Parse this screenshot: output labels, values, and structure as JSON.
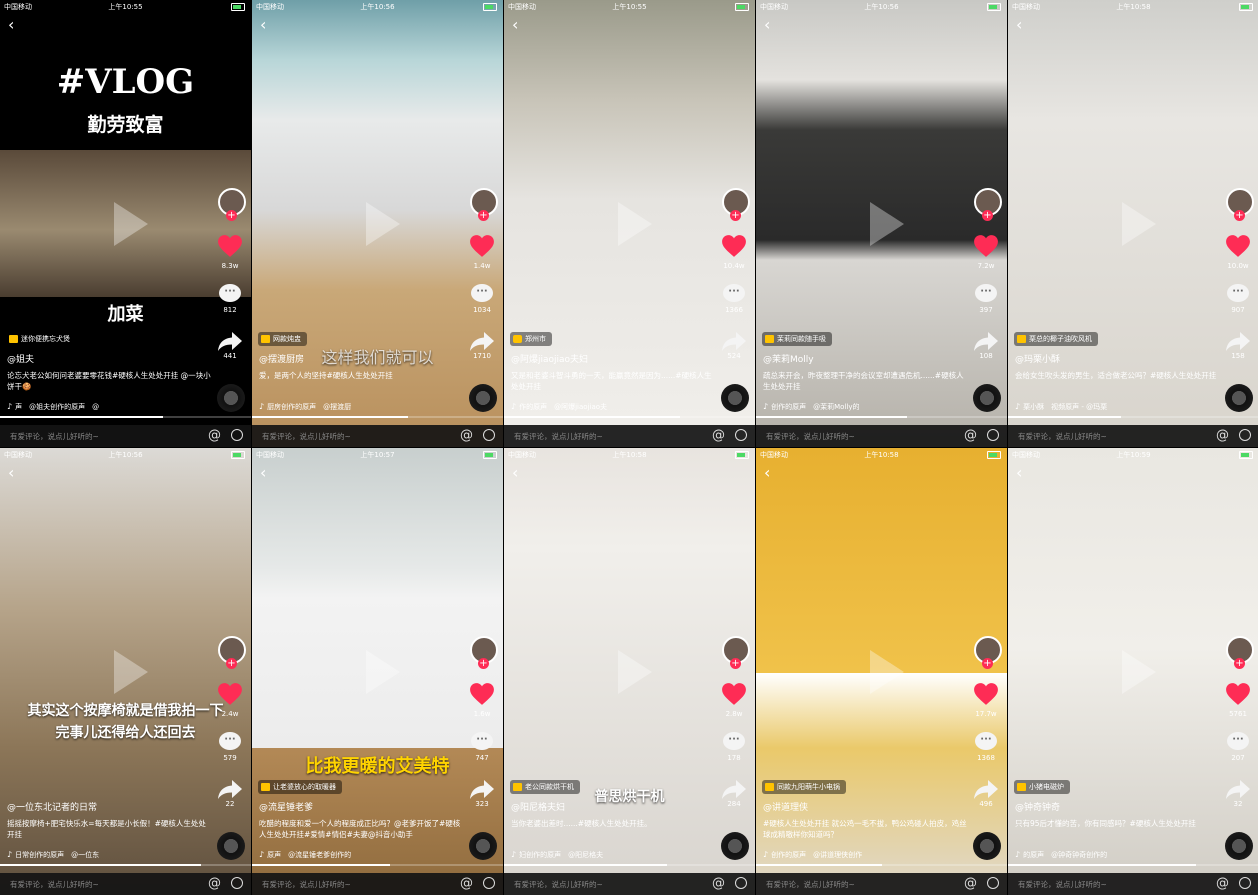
{
  "ui": {
    "back_glyph": "‹",
    "comment_placeholder": "有爱评论，说点儿好听的~",
    "at_glyph": "@",
    "follow_glyph": "+",
    "music_glyph": "♪",
    "carrier": "中国移动",
    "accent": "#fe2c55",
    "icons": [
      "back-icon",
      "heart-icon",
      "comment-icon",
      "share-icon",
      "music-disc-icon",
      "cart-icon",
      "at-icon",
      "emoji-icon",
      "play-icon"
    ]
  },
  "panels": [
    {
      "time": "上午10:55",
      "overlay": [
        "#VLOG",
        "勤劳致富",
        "加菜"
      ],
      "likes": "8.3w",
      "comments": "812",
      "shares": "441",
      "tag": "迷你便携忘犬煲",
      "author": "@姐夫",
      "desc": "论忘犬老公如何问老婆要零花钱#硬核人生处处开挂 @一块小饼干🍪",
      "music": "声　@姐夫创作的原声　@",
      "progress": 0.65
    },
    {
      "time": "上午10:56",
      "overlay": [
        "这样我们就可以"
      ],
      "likes": "1.4w",
      "comments": "1034",
      "shares": "1710",
      "tag": "网款炖盅",
      "author": "@摆渡厨房",
      "desc": "爱，是两个人的坚持#硬核人生处处开挂",
      "music": "厨房创作的原声　@摆渡厨",
      "progress": 0.62
    },
    {
      "time": "上午10:55",
      "overlay": [],
      "likes": "10.4w",
      "comments": "1366",
      "shares": "524",
      "tag": "郑州市",
      "author": "@阿爆jiaojiao夫妇",
      "desc": "又是和老婆斗智斗勇的一天，能赢竟然是因为......#硬核人生处处开挂",
      "music": "作的原声　@阿爆jiaojiao夫",
      "progress": 0.7
    },
    {
      "time": "上午10:56",
      "overlay": [],
      "likes": "7.2w",
      "comments": "397",
      "shares": "108",
      "tag": "茉莉同款随手吸",
      "author": "@茉莉Molly",
      "desc": "疏总来开会，昨夜整理干净的会议室却遭遇危机......#硬核人生处处开挂",
      "music": "创作的原声　@茉莉Molly的",
      "progress": 0.6
    },
    {
      "time": "上午10:58",
      "overlay": [],
      "likes": "10.0w",
      "comments": "907",
      "shares": "158",
      "tag": "栗总的椰子油吹风机",
      "author": "@玛栗小酥",
      "desc": "会给女生吹头发的男生，适合做老公吗？#硬核人生处处开挂",
      "music": "栗小酥　视频原声 - @玛栗",
      "progress": 0.45
    },
    {
      "time": "上午10:56",
      "overlay": [
        "其实这个按摩椅就是借我拍一下",
        "完事儿还得给人还回去"
      ],
      "likes": "2.4w",
      "comments": "579",
      "shares": "22",
      "tag": "",
      "author": "@一位东北记者的日常",
      "desc": "摇摇按摩椅+肥宅快乐水=每天都是小长假！#硬核人生处处开挂",
      "music": "日常创作的原声　@一位东",
      "progress": 0.8
    },
    {
      "time": "上午10:57",
      "overlay": [
        "比我更暖的艾美特"
      ],
      "likes": "1.6w",
      "comments": "747",
      "shares": "323",
      "tag": "让老婆放心的取暖器",
      "author": "@流星锤老爹",
      "desc": "吃醋的程度和爱一个人的程度成正比吗？@老爹开饭了#硬核人生处处开挂#爱情#情侣#夫妻@抖音小助手",
      "music": "原声　@流星锤老爹创作的",
      "progress": 0.55
    },
    {
      "time": "上午10:58",
      "overlay": [
        "普思烘干机"
      ],
      "likes": "2.8w",
      "comments": "178",
      "shares": "284",
      "tag": "老公同款烘干机",
      "author": "@阳尼格夫妇",
      "desc": "当你老婆出差时......#硬核人生处处开挂。",
      "music": "妇创作的原声　@阳尼格夫",
      "progress": 0.65
    },
    {
      "time": "上午10:58",
      "overlay": [],
      "likes": "17.7w",
      "comments": "1368",
      "shares": "496",
      "tag": "同款九阳萌牛小电锅",
      "author": "@讲道理侠",
      "desc": "#硬核人生处处开挂 就公鸡一毛不拔，鸭公鸡碰人拍皮，鸡丝球成精嗷样你知道吗？",
      "music": "创作的原声　@讲道理侠创作",
      "progress": 0.5
    },
    {
      "time": "上午10:59",
      "overlay": [],
      "likes": "5761",
      "comments": "207",
      "shares": "32",
      "tag": "小猪电磁炉",
      "author": "@钟奇钟奇",
      "desc": "只有95后才懂的苦，你有同感吗？#硬核人生处处开挂",
      "music": "的原声　@钟奇钟奇创作的",
      "progress": 0.75
    }
  ]
}
